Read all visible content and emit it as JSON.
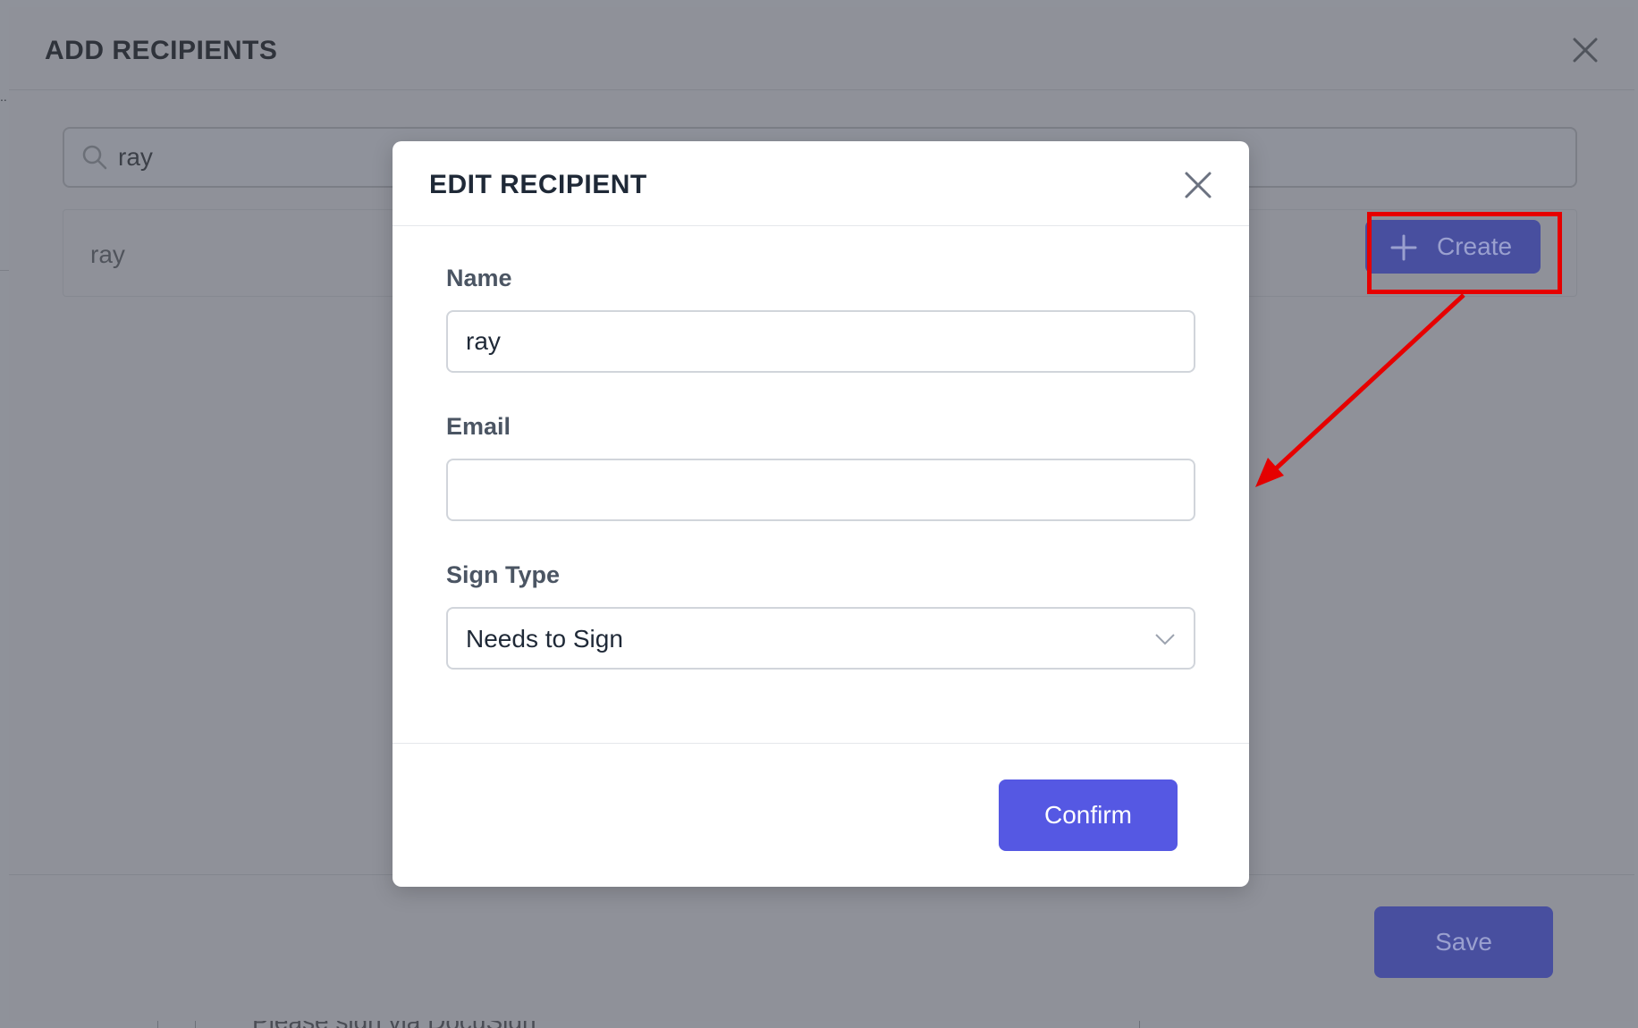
{
  "outer_modal": {
    "title": "ADD RECIPIENTS",
    "close_icon": "close-icon",
    "search": {
      "value": "ray",
      "icon": "search-icon"
    },
    "result": {
      "name": "ray"
    },
    "create_button": {
      "label": "Create",
      "icon": "plus-icon"
    },
    "save_label": "Save"
  },
  "background": {
    "partial_text": "Please sign via DocuSign"
  },
  "inner_modal": {
    "title": "EDIT RECIPIENT",
    "close_icon": "close-icon",
    "fields": {
      "name": {
        "label": "Name",
        "value": "ray"
      },
      "email": {
        "label": "Email",
        "value": ""
      },
      "sign_type": {
        "label": "Sign Type",
        "value": "Needs to Sign",
        "icon": "chevron-down-icon"
      }
    },
    "confirm_label": "Confirm"
  },
  "colors": {
    "accent": "#5558e3",
    "annotation": "#e60000",
    "overlay": "#8f929a"
  }
}
